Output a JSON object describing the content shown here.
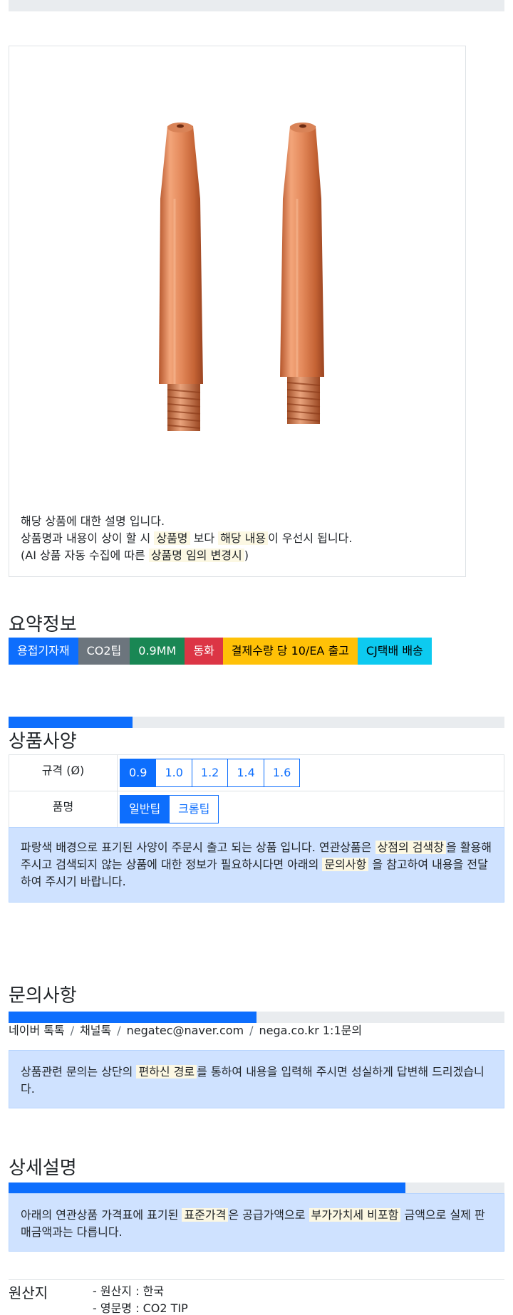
{
  "product_image": {
    "alt": "CO2 welding tip product image"
  },
  "description_card": {
    "line1": "해당 상품에 대한 설명 입니다.",
    "line2_pre": "상품명과 내용이 상이 할 시 ",
    "line2_mark1": "상품명",
    "line2_mid": " 보다 ",
    "line2_mark2": "해당 내용",
    "line2_post": "이 우선시 됩니다.",
    "line3_pre": "(AI 상품 자동 수집에 따른 ",
    "line3_mark": "상품명 임의 변경시",
    "line3_post": ")"
  },
  "summary": {
    "title": "요약정보",
    "badges": [
      {
        "label": "용접기자재",
        "color": "#0d6efd",
        "text_color": "#ffffff"
      },
      {
        "label": "CO2팁",
        "color": "#6c757d",
        "text_color": "#ffffff"
      },
      {
        "label": "0.9MM",
        "color": "#198754",
        "text_color": "#ffffff"
      },
      {
        "label": "동화",
        "color": "#dc3545",
        "text_color": "#ffffff"
      },
      {
        "label": "결제수량 당 10/EA 출고",
        "color": "#ffc107",
        "text_color": "#000000"
      },
      {
        "label": "CJ택배 배송",
        "color": "#0dcaf0",
        "text_color": "#000000"
      }
    ]
  },
  "specs": {
    "title": "상품사양",
    "progress_fraction": 0.25,
    "rows": [
      {
        "label": "규격 (Ø)",
        "options": [
          "0.9",
          "1.0",
          "1.2",
          "1.4",
          "1.6"
        ],
        "selected": "0.9"
      },
      {
        "label": "품명",
        "options": [
          "일반팁",
          "크롬팁"
        ],
        "selected": "일반팁"
      }
    ],
    "notice": {
      "pre": "파랑색 배경으로 표기된 사양이 주문시 출고 되는 상품 입니다. 연관상품은 ",
      "mark1": "상점의 검색창",
      "mid": "을 활용해 주시고 검색되지 않는 상품에 대한 정보가 필요하시다면 아래의 ",
      "mark2": "문의사항",
      "post": " 을 참고하여 내용을 전달하여 주시기 바랍니다."
    }
  },
  "inquiry": {
    "title": "문의사항",
    "progress_fraction": 0.5,
    "contacts": [
      "네이버 톡톡",
      "채널톡",
      "negatec@naver.com",
      "nega.co.kr 1:1문의"
    ],
    "separator": "/",
    "notice": {
      "pre": "상품관련 문의는 상단의 ",
      "mark": "편하신 경로",
      "post": "를 통하여 내용을 입력해 주시면 성실하게 답변해 드리겠습니다."
    }
  },
  "detail": {
    "title": "상세설명",
    "progress_fraction": 0.8,
    "notice": {
      "pre": "아래의 연관상품 가격표에 표기된 ",
      "mark1": "표준가격",
      "mid": "은 공급가액으로 ",
      "mark2": "부가가치세 비포함",
      "post": " 금액으로 실제 판매금액과는 다릅니다."
    }
  },
  "origin": {
    "label": "원산지",
    "lines": [
      "- 원산지 : 한국",
      "- 영문명 : CO2 TIP"
    ]
  }
}
